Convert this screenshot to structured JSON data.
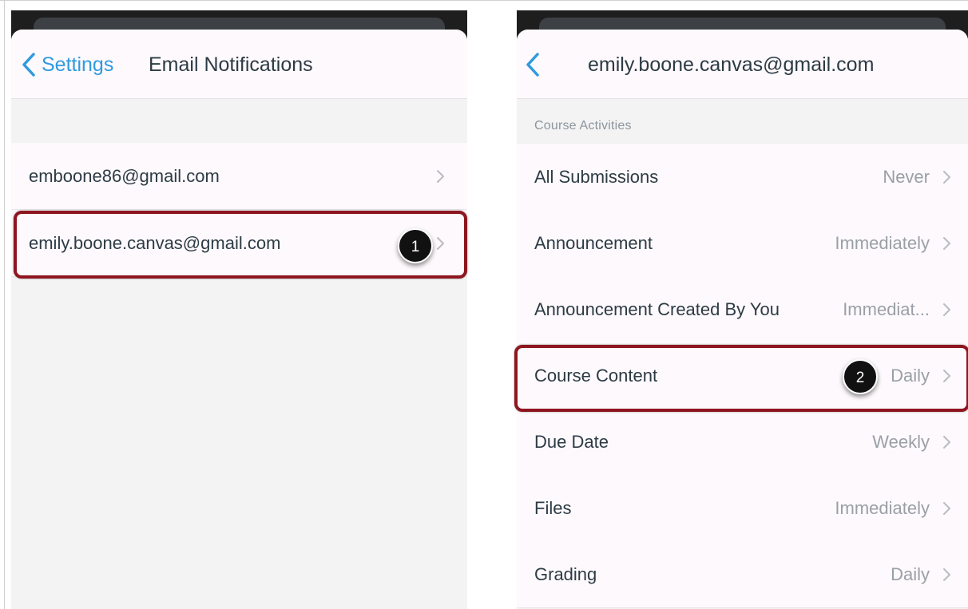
{
  "left_screen": {
    "back_label": "Settings",
    "title": "Email Notifications",
    "emails": [
      {
        "address": "emboone86@gmail.com"
      },
      {
        "address": "emily.boone.canvas@gmail.com"
      }
    ],
    "step_badge": "1"
  },
  "right_screen": {
    "title": "emily.boone.canvas@gmail.com",
    "section_header": "Course Activities",
    "items": [
      {
        "label": "All Submissions",
        "value": "Never"
      },
      {
        "label": "Announcement",
        "value": "Immediately"
      },
      {
        "label": "Announcement Created By You",
        "value": "Immediat..."
      },
      {
        "label": "Course Content",
        "value": "Daily"
      },
      {
        "label": "Due Date",
        "value": "Weekly"
      },
      {
        "label": "Files",
        "value": "Immediately"
      },
      {
        "label": "Grading",
        "value": "Daily"
      }
    ],
    "step_badge": "2"
  },
  "colors": {
    "accent": "#2f9ae0",
    "highlight": "#8e1620",
    "text": "#2d3b45",
    "muted": "#9aa0a6"
  }
}
